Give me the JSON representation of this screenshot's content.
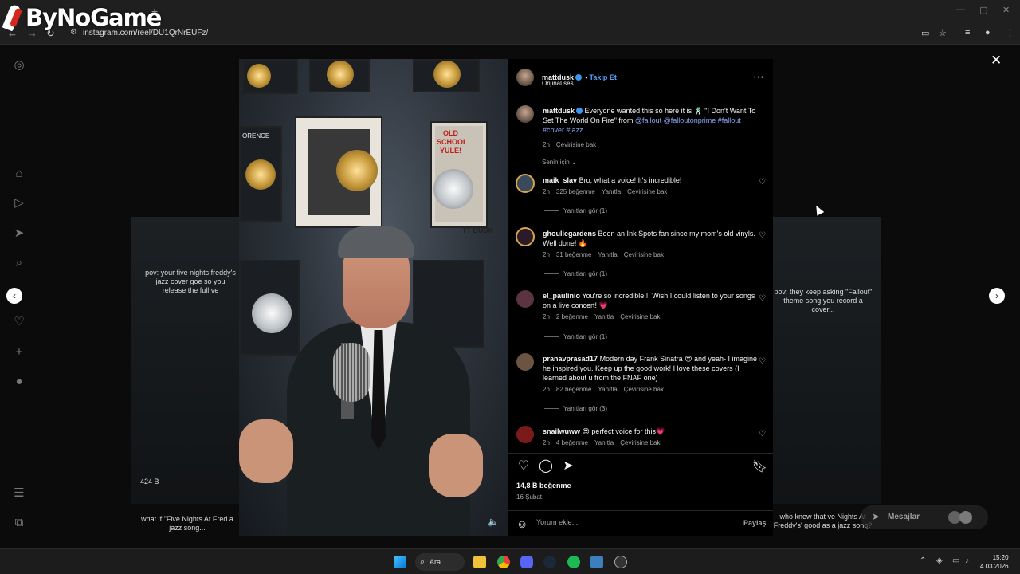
{
  "browser": {
    "logo_text": "ByNoGame",
    "url": "instagram.com/reel/DU1QrNrEUFz/"
  },
  "bg_reels": {
    "left_caption": "pov: your five nights freddy's jazz cover goe so you release the full ve",
    "left_views": "424 B",
    "left_bottom_caption": "what if \"Five Nights At Fred a jazz song...",
    "right_caption": "pov: they keep asking \"Fallout\" theme song you record a cover...",
    "right_bottom_caption": "who knew that ve Nights At Freddy's' good as a jazz song?"
  },
  "post": {
    "username": "mattdusk",
    "follow_label": "Takip Et",
    "audio": "Orijinal ses",
    "caption_user": "mattdusk",
    "caption_text": "Everyone wanted this so here it is 🕺 \"I Don't Want To Set The World On Fire\" from",
    "caption_link1": "@fallout",
    "caption_link2": "@falloutonprime",
    "caption_tags": "#fallout #cover #jazz",
    "caption_time": "2h",
    "caption_translate": "Çevirisine bak",
    "sort_label": "Senin için",
    "likes": "14,8 B beğenme",
    "date": "16 Şubat",
    "comment_placeholder": "Yorum ekle...",
    "share_label": "Paylaş"
  },
  "comments": [
    {
      "user": "maik_slav",
      "text": "Bro, what a voice! It's incredible!",
      "time": "2h",
      "likes": "325 beğenme",
      "reply": "Yanıtla",
      "translate": "Çevirisine bak",
      "replies": "Yanıtları gör (1)"
    },
    {
      "user": "ghouliegardens",
      "text": "Been an Ink Spots fan since my mom's old vinyls. Well done! 🔥",
      "time": "2h",
      "likes": "31 beğenme",
      "reply": "Yanıtla",
      "translate": "Çevirisine bak",
      "replies": "Yanıtları gör (1)"
    },
    {
      "user": "el_paulinio",
      "text": "You're so incredible!!! Wish I could listen to your songs on a live concert! 💗",
      "time": "2h",
      "likes": "2 beğenme",
      "reply": "Yanıtla",
      "translate": "Çevirisine bak",
      "replies": "Yanıtları gör (1)"
    },
    {
      "user": "pranavprasad17",
      "text": "Modern day Frank Sinatra 😍 and yeah- I imagine he inspired you. Keep up the good work! I love these covers (I learned about u from the FNAF one)",
      "time": "2h",
      "likes": "82 beğenme",
      "reply": "Yanıtla",
      "translate": "Çevirisine bak",
      "replies": "Yanıtları gör (3)"
    },
    {
      "user": "snailwuww",
      "text": "😍 perfect voice for this💗",
      "time": "2h",
      "likes": "4 beğenme",
      "reply": "Yanıtla",
      "translate": "Çevirisine bak",
      "replies": ""
    }
  ],
  "video_text": {
    "poster_old": "OLD",
    "poster_school": "SCHOOL",
    "poster_yule": "YULE!",
    "frame_name": "ORENCE",
    "frame_dusk": "TT DUSK"
  },
  "messages": {
    "label": "Mesajlar"
  },
  "taskbar": {
    "search_label": "Ara",
    "time": "15:20",
    "date": "4.03.2026"
  },
  "colors": {
    "accent": "#5aa2ff",
    "link": "#8ca7f0",
    "verified": "#3897f0"
  },
  "icons": [
    "instagram-icon",
    "home-icon",
    "reels-icon",
    "send-icon",
    "search-icon",
    "heart-icon",
    "plus-icon",
    "menu-icon",
    "more-icon",
    "close-icon",
    "chevron-left-icon",
    "chevron-right-icon",
    "comment-icon",
    "share-icon",
    "bookmark-icon",
    "emoji-icon",
    "speaker-icon"
  ]
}
